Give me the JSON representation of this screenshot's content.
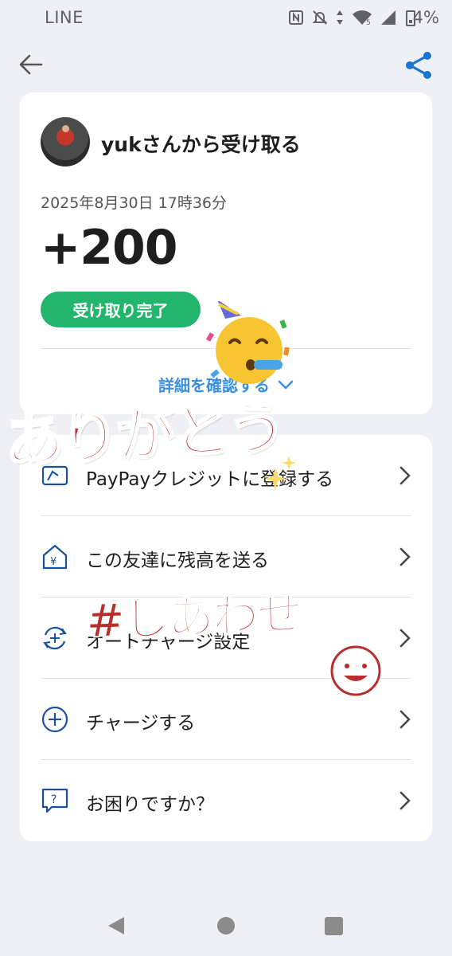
{
  "status_bar": {
    "app_name": "LINE",
    "battery_percent": "4%",
    "icons": [
      "nfc-icon",
      "notifications-off-icon",
      "data-arrows-icon",
      "wifi-icon",
      "signal-icon",
      "battery-charging-icon"
    ],
    "wifi_badge": "5"
  },
  "header": {
    "back_icon": "arrow-left-icon",
    "share_icon": "share-icon",
    "accent_color": "#1a75d2"
  },
  "receipt": {
    "sender_text": "yukさんから受け取る",
    "datetime": "2025年8月30日 17時36分",
    "amount": "+200",
    "status_badge": "受け取り完了",
    "status_color": "#21b66b",
    "details_link": "詳細を確認する"
  },
  "menu": {
    "items": [
      {
        "label": "PayPayクレジットに登録する",
        "icon": "paypay-card-icon"
      },
      {
        "label": "この友達に残高を送る",
        "icon": "house-yen-icon"
      },
      {
        "label": "オートチャージ設定",
        "icon": "auto-charge-icon"
      },
      {
        "label": "チャージする",
        "icon": "plus-circle-icon"
      },
      {
        "label": "お困りですか？",
        "icon": "help-chat-icon"
      }
    ]
  },
  "stickers": {
    "thanks": "ありがとう",
    "happy": "#しあわせ"
  },
  "nav_bar": {
    "buttons": [
      "nav-back-icon",
      "nav-home-icon",
      "nav-recents-icon"
    ]
  }
}
